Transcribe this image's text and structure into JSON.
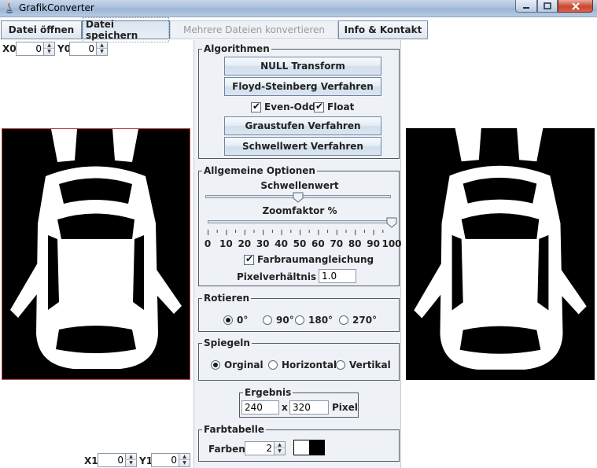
{
  "window": {
    "title": "GrafikConverter"
  },
  "toolbar": {
    "open": "Datei öffnen",
    "save": "Datei speichern",
    "batch": "Mehrere Dateien konvertieren",
    "info": "Info & Kontakt"
  },
  "coords": {
    "x0_label": "X0",
    "x0_value": "0",
    "y0_label": "Y0",
    "y0_value": "0",
    "x1_label": "X1",
    "x1_value": "0",
    "y1_label": "Y1",
    "y1_value": "0"
  },
  "algorithms": {
    "legend": "Algorithmen",
    "null_transform": "NULL Transform",
    "floyd": "Floyd-Steinberg Verfahren",
    "even_odd": "Even-Odd",
    "float": "Float",
    "grayscale": "Graustufen Verfahren",
    "threshold": "Schwellwert Verfahren"
  },
  "options": {
    "legend": "Allgemeine Optionen",
    "threshold_label": "Schwellenwert",
    "threshold_value": 0.5,
    "zoom_label": "Zoomfaktor %",
    "zoom_value": 100,
    "zoom_ticks": [
      "0",
      "10",
      "20",
      "30",
      "40",
      "50",
      "60",
      "70",
      "80",
      "90",
      "100"
    ],
    "color_adjust": "Farbraumangleichung",
    "pixel_ratio_label": "Pixelverhältnis 1 :",
    "pixel_ratio_value": "1.0"
  },
  "rotate": {
    "legend": "Rotieren",
    "options": [
      "0°",
      "90°",
      "180°",
      "270°"
    ],
    "selected": 0
  },
  "mirror": {
    "legend": "Spiegeln",
    "options": [
      "Orginal",
      "Horizontal",
      "Vertikal"
    ],
    "selected": 0
  },
  "result": {
    "legend": "Ergebnis",
    "width": "240",
    "x": "x",
    "height": "320",
    "unit": "Pixel"
  },
  "palette": {
    "legend": "Farbtabelle",
    "colors_label": "Farben:",
    "colors_value": "2",
    "swatches": [
      "#ffffff",
      "#000000"
    ]
  }
}
